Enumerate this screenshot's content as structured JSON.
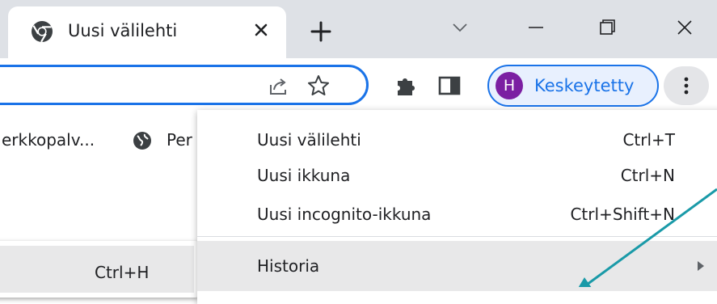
{
  "tab": {
    "title": "Uusi välilehti",
    "favicon": "chrome-icon",
    "close_icon": "close-icon"
  },
  "titlebar_icons": [
    "plus-icon",
    "chevron-down-icon",
    "minimize-icon",
    "restore-icon",
    "close-window-icon"
  ],
  "toolbar": {
    "icons": [
      "share-icon",
      "star-icon",
      "extensions-icon",
      "side-panel-icon",
      "more-vert-icon"
    ],
    "profile": {
      "initial": "H",
      "label": "Keskeytetty"
    },
    "accent": "#1a73e8",
    "avatar_color": "#7b1fa2"
  },
  "bookmarks": {
    "items": [
      {
        "label": "erkkopalv..."
      },
      {
        "label": "Per",
        "icon": "globe-icon"
      }
    ]
  },
  "history_submenu": {
    "shortcut": "Ctrl+H"
  },
  "menu": {
    "items": [
      {
        "label": "Uusi välilehti",
        "shortcut": "Ctrl+T"
      },
      {
        "label": "Uusi ikkuna",
        "shortcut": "Ctrl+N"
      },
      {
        "label": "Uusi incognito-ikkuna",
        "shortcut": "Ctrl+Shift+N"
      },
      {
        "label": "Historia",
        "icon": "submenu-arrow-icon"
      }
    ],
    "highlight_color": "#e8e8e9"
  },
  "annotation": {
    "arrow_color": "#1a9aa8",
    "icon": "arrow-annotation-icon"
  }
}
